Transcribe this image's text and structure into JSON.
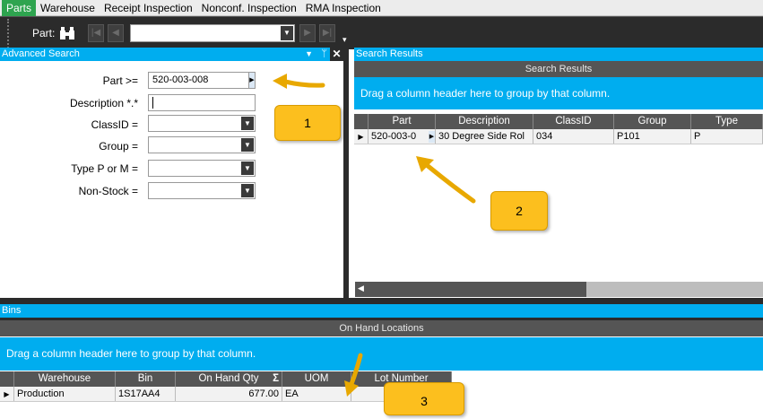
{
  "menu": {
    "items": [
      "Parts",
      "Warehouse",
      "Receipt Inspection",
      "Nonconf. Inspection",
      "RMA Inspection"
    ]
  },
  "toolbar": {
    "part_label": "Part:",
    "part_value": ""
  },
  "advanced_search": {
    "title": "Advanced Search",
    "fields": [
      {
        "label": "Part >=",
        "value": "520-003-008"
      },
      {
        "label": "Description *.*",
        "value": ""
      },
      {
        "label": "ClassID =",
        "value": ""
      },
      {
        "label": "Group =",
        "value": ""
      },
      {
        "label": "Type P or  M =",
        "value": ""
      },
      {
        "label": "Non-Stock =",
        "value": ""
      }
    ]
  },
  "search_results": {
    "title": "Search Results",
    "header": "Search Results",
    "group_hint": "Drag a column header here to group by that column.",
    "columns": [
      "Part",
      "Description",
      "ClassID",
      "Group",
      "Type"
    ],
    "rows": [
      {
        "part": "520-003-0",
        "description": "30 Degree Side Rol",
        "classid": "034",
        "group": "P101",
        "type": "P"
      }
    ]
  },
  "bins": {
    "title": "Bins",
    "header": "On Hand Locations",
    "group_hint": "Drag a column header here to group by that column.",
    "columns": [
      "Warehouse",
      "Bin",
      "On Hand Qty",
      "UOM",
      "Lot Number"
    ],
    "rows": [
      {
        "warehouse": "Production",
        "bin": "1S17AA4",
        "qty": "677.00",
        "uom": "EA",
        "lot": ""
      }
    ]
  },
  "callouts": [
    "1",
    "2",
    "3"
  ],
  "colors": {
    "accent": "#00adef",
    "callout": "#fcbf1e",
    "toolbar": "#2b2b2b",
    "active_tab": "#2ea44f"
  }
}
